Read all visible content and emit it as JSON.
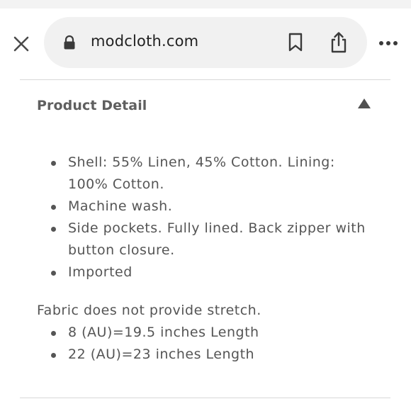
{
  "browser": {
    "url": "modcloth.com",
    "icons": {
      "close": "close-icon",
      "lock": "lock-icon",
      "bookmark": "bookmark-icon",
      "share": "share-icon",
      "more": "more-horizontal-icon"
    }
  },
  "product_detail": {
    "title": "Product Detail",
    "expanded": true,
    "toggle_icon": "triangle-up-icon",
    "bullets": [
      "Shell: 55% Linen, 45% Cotton. Lining: 100% Cotton.",
      "Machine wash.",
      "Side pockets. Fully lined. Back zipper with button closure.",
      "Imported"
    ],
    "stretch_note": "Fabric does not provide stretch.",
    "sizes": [
      "8 (AU)=19.5 inches Length",
      "22 (AU)=23 inches Length"
    ]
  },
  "colors": {
    "text": "#555555",
    "heading": "#5f5f5f",
    "url_bar_bg": "#f1f1f1",
    "divider": "#d8d8d8"
  }
}
